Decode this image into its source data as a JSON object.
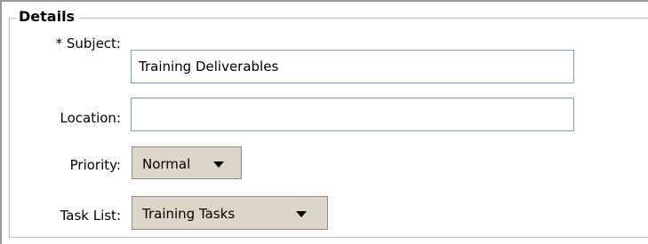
{
  "details": {
    "legend": "Details",
    "subject": {
      "label": "* Subject:",
      "value": "Training Deliverables"
    },
    "location": {
      "label": "Location:",
      "value": ""
    },
    "priority": {
      "label": "Priority:",
      "selected": "Normal"
    },
    "task_list": {
      "label": "Task List:",
      "selected": "Training Tasks"
    }
  },
  "icons": {
    "dropdown_arrow": "chevron-down-icon"
  }
}
